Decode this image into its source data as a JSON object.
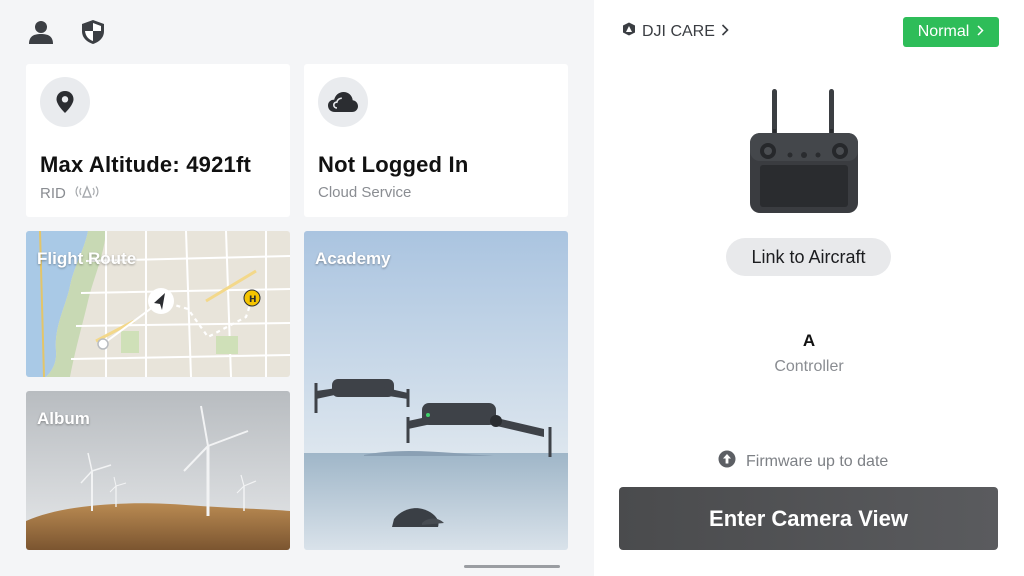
{
  "cards": {
    "altitude": {
      "title": "Max Altitude: 4921ft",
      "subtitle": "RID"
    },
    "cloud": {
      "title": "Not Logged In",
      "subtitle": "Cloud Service"
    }
  },
  "tiles": {
    "flight_route": "Flight Route",
    "album": "Album",
    "academy": "Academy"
  },
  "right": {
    "care_label": "DJI CARE",
    "status_label": "Normal",
    "link_button": "Link to Aircraft",
    "controller_letter": "A",
    "controller_label": "Controller",
    "firmware_status": "Firmware up to date",
    "enter_button": "Enter Camera View"
  },
  "colors": {
    "status_green": "#2ebd59",
    "map_marker_yellow": "#f5c400"
  },
  "icons": {
    "top_left": [
      "person-icon",
      "shield-icon"
    ],
    "altitude_card": "location-pin-icon",
    "cloud_card": "cloud-icon"
  }
}
